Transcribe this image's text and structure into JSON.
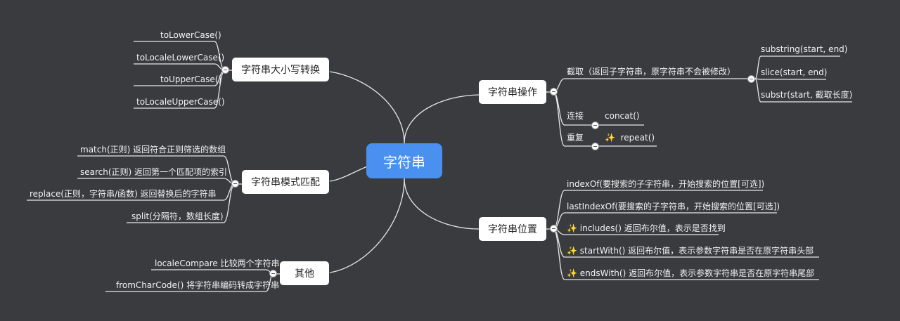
{
  "root": "字符串",
  "sections": {
    "case": {
      "label": "字符串大小写转换",
      "items": [
        "toLowerCase()",
        "toLocaleLowerCase()",
        "toUpperCase()",
        "toLocaleUpperCase()"
      ]
    },
    "pattern": {
      "label": "字符串模式匹配",
      "items": [
        "match(正则) 返回符合正则筛选的数组",
        "search(正则) 返回第一个匹配项的索引",
        "replace(正则，字符串/函数) 返回替换后的字符串",
        "split(分隔符，数组长度)"
      ]
    },
    "other": {
      "label": "其他",
      "items": [
        "localeCompare 比较两个字符串",
        "fromCharCode() 将字符串编码转成字符串"
      ]
    },
    "ops": {
      "label": "字符串操作",
      "cut": {
        "label": "截取（返回子字符串，原字符串不会被修改）",
        "items": [
          "substring(start, end)",
          "slice(start, end)",
          "substr(start, 截取长度)"
        ]
      },
      "concat": {
        "label": "连接",
        "item": "concat()"
      },
      "repeat": {
        "label": "重复",
        "item": "repeat()"
      }
    },
    "position": {
      "label": "字符串位置",
      "items": [
        "indexOf(要搜索的子字符串，开始搜索的位置[可选])",
        "lastIndexOf(要搜索的子字符串，开始搜索的位置[可选])",
        "includes() 返回布尔值，表示是否找到",
        "startWith()  返回布尔值，表示参数字符串是否在原字符串头部",
        "endsWith()  返回布尔值，表示参数字符串是否在原字符串尾部"
      ]
    }
  },
  "colors": {
    "background": "#3a3b3f",
    "root": "#4a90f1",
    "line": "#e6e6e6",
    "sparkle": "#ffd84a"
  },
  "icons": {
    "sparkle": "sparkle-icon",
    "collapse": "collapse-toggle-icon"
  }
}
